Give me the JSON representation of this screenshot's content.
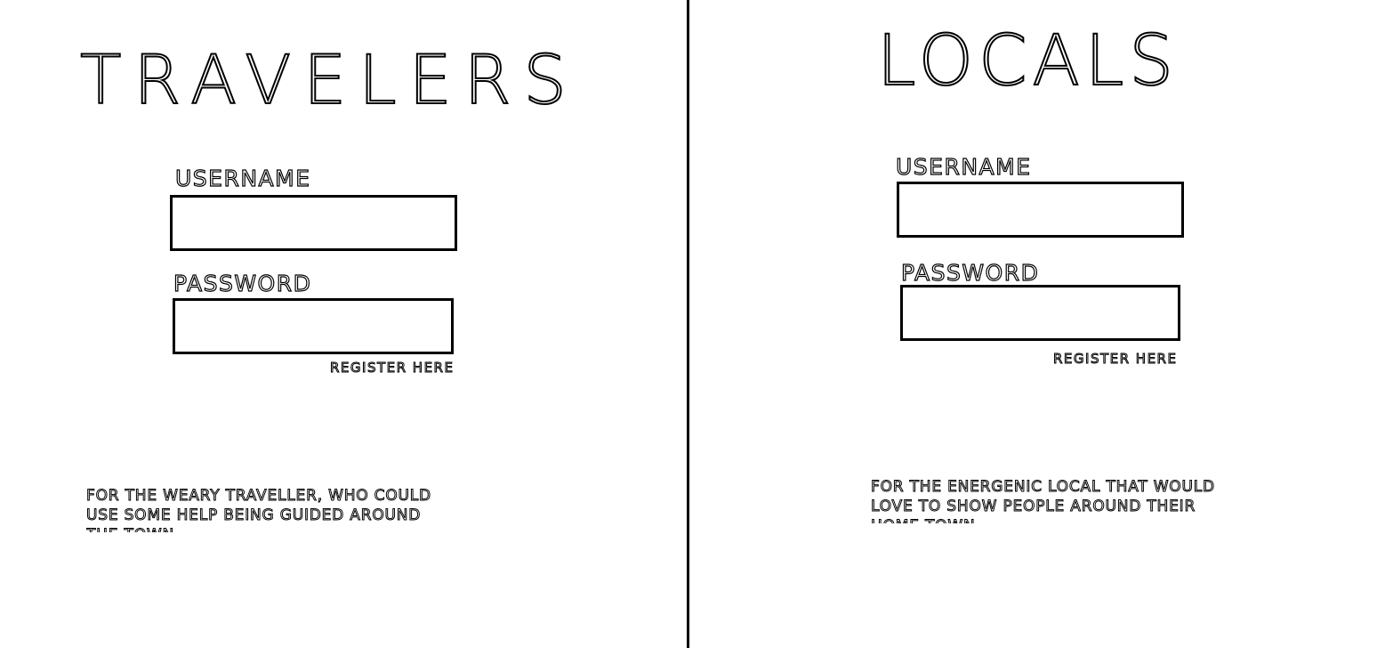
{
  "travelers": {
    "title": "TRAVELERS",
    "username_label": "USERNAME",
    "password_label": "PASSWORD",
    "username_value": "",
    "password_value": "",
    "register_link": "REGISTER HERE",
    "tagline": "FOR THE WEARY TRAVELLER, WHO COULD USE SOME HELP BEING GUIDED AROUND THE TOWN"
  },
  "locals": {
    "title": "LOCALS",
    "username_label": "USERNAME",
    "password_label": "PASSWORD",
    "username_value": "",
    "password_value": "",
    "register_link": "REGISTER HERE",
    "tagline": "FOR THE ENERGENIC LOCAL THAT WOULD LOVE TO SHOW PEOPLE AROUND THEIR HOME TOWN"
  },
  "colors": {
    "background": "#ffffff",
    "stroke": "#000000"
  }
}
